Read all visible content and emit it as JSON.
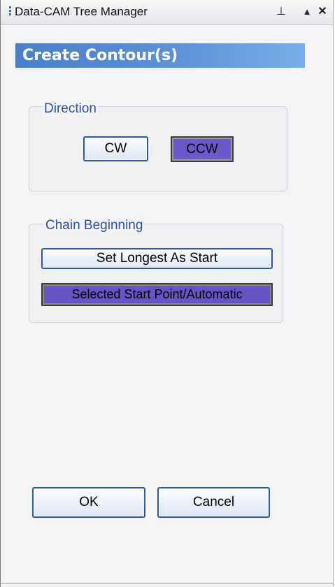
{
  "window": {
    "title": "Data-CAM Tree Manager",
    "pin_icon": "pin-icon",
    "expand_icon": "triangle-up-icon",
    "close_icon": "close-icon"
  },
  "panel": {
    "header": "Create Contour(s)"
  },
  "direction": {
    "label": "Direction",
    "cw_label": "CW",
    "ccw_label": "CCW",
    "selected": "CCW"
  },
  "chain": {
    "label": "Chain Beginning",
    "longest_label": "Set Longest As Start",
    "start_point_label": "Selected Start Point/Automatic",
    "selected": "Selected Start Point/Automatic"
  },
  "actions": {
    "ok_label": "OK",
    "cancel_label": "Cancel"
  },
  "colors": {
    "accent": "#2d56b4",
    "header_blue": "#5f93d6",
    "selected_purple": "#6a58cc",
    "group_label": "#2c4ea8"
  }
}
